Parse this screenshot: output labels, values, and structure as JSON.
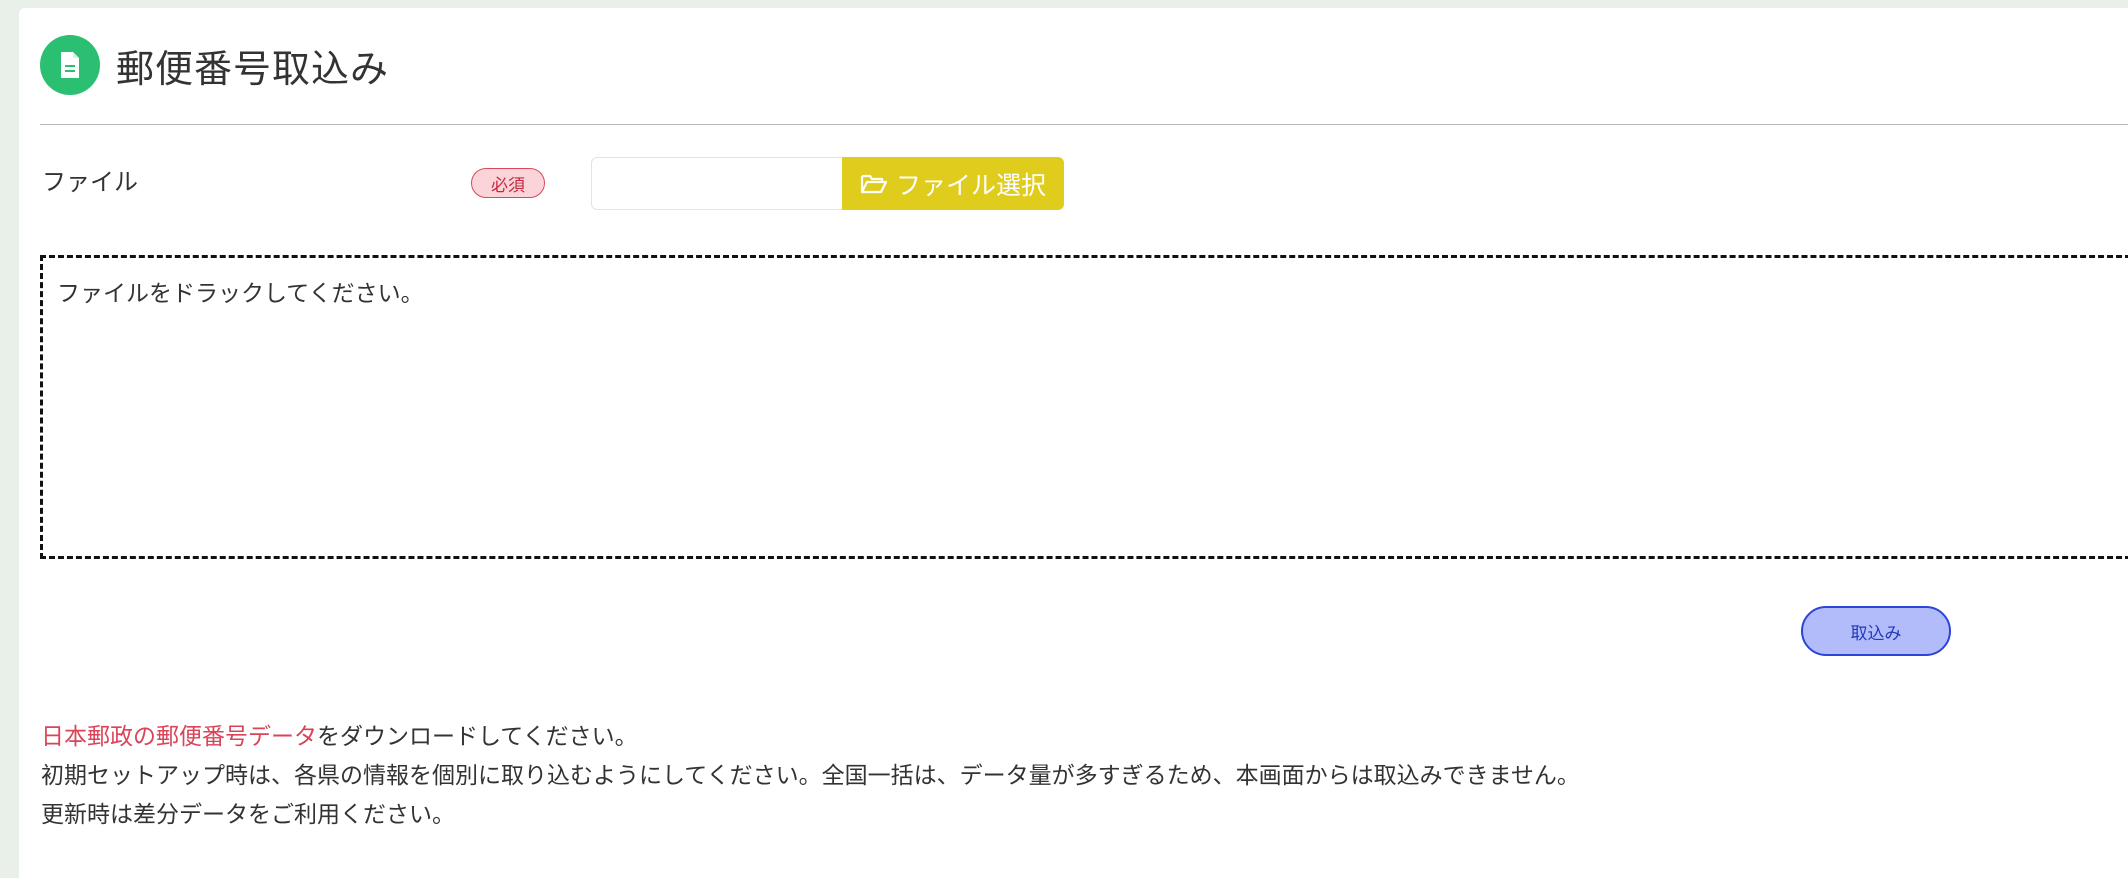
{
  "header": {
    "title": "郵便番号取込み",
    "icon": "document-icon",
    "icon_color": "#2bbf72"
  },
  "form": {
    "file_label": "ファイル",
    "required_badge": "必須",
    "file_input_value": "",
    "file_button_label": "ファイル選択",
    "file_button_icon": "folder-open-icon",
    "file_button_color": "#dfcc1d"
  },
  "drop_zone": {
    "text": "ファイルをドラックしてください。"
  },
  "actions": {
    "import_label": "取込み"
  },
  "notes": {
    "link_text": "日本郵政の郵便番号データ",
    "line1_rest": "をダウンロードしてください。",
    "line2": "初期セットアップ時は、各県の情報を個別に取り込むようにしてください。全国一括は、データ量が多すぎるため、本画面からは取込みできません。",
    "line3": "更新時は差分データをご利用ください。",
    "link_color": "#d94459"
  }
}
